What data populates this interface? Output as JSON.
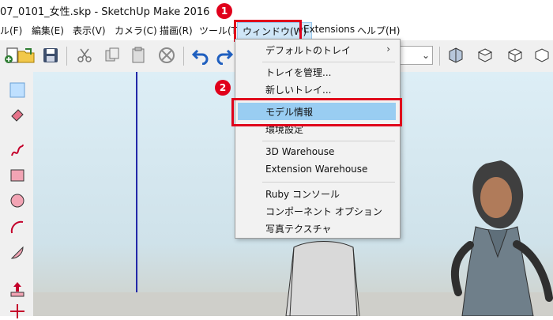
{
  "title": "07_0101_女性.skp - SketchUp Make 2016",
  "menubar": {
    "items": [
      "ル(F)",
      "編集(E)",
      "表示(V)",
      "カメラ(C)",
      "描画(R)",
      "ツール(T)",
      "ウィンドウ(W)",
      "Extensions",
      "ヘルプ(H)"
    ]
  },
  "annotations": {
    "step1": "1",
    "step2": "2"
  },
  "window_menu": {
    "items": [
      {
        "label": "デフォルトのトレイ",
        "submenu": "›"
      },
      {
        "label": "トレイを管理..."
      },
      {
        "label": "新しいトレイ..."
      },
      {
        "label": "モデル情報"
      },
      {
        "label": "環境設定"
      },
      {
        "label": "3D Warehouse"
      },
      {
        "label": "Extension Warehouse"
      },
      {
        "label": "Ruby コンソール"
      },
      {
        "label": "コンポーネント オプション"
      },
      {
        "label": "写真テクスチャ"
      }
    ]
  },
  "toolbar": {
    "dropdown_chevron": "⌄"
  },
  "colors": {
    "highlight": "#99cdf2",
    "annotation_red": "#e0001b",
    "axis_blue": "#2328a8"
  },
  "icons": [
    "new-icon",
    "open-icon",
    "save-icon",
    "cut-icon",
    "copy-icon",
    "paste-icon",
    "erase-icon",
    "undo-icon",
    "redo-icon",
    "iso-view-icon",
    "top-view-icon",
    "front-view-icon",
    "right-view-icon"
  ]
}
